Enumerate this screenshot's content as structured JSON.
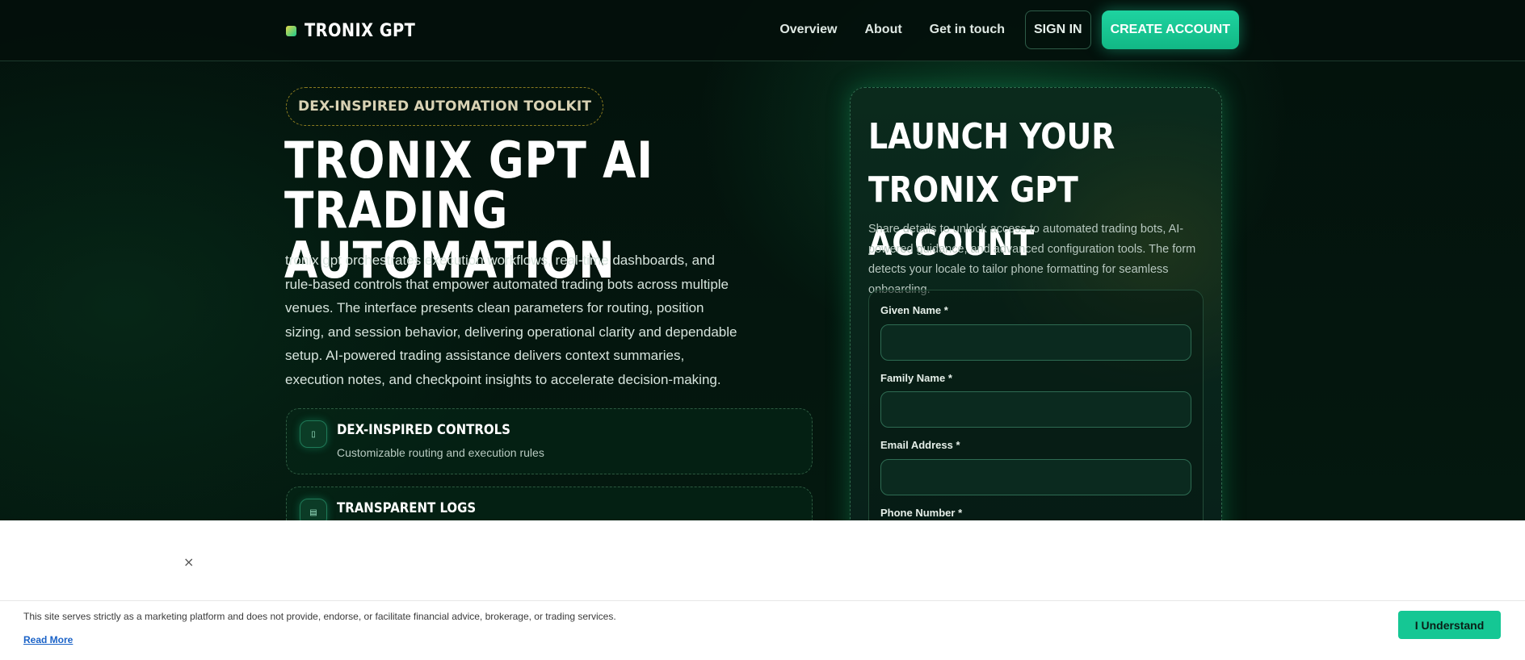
{
  "header": {
    "brand": "TRONIX GPT",
    "nav": [
      {
        "label": "Overview"
      },
      {
        "label": "About"
      },
      {
        "label": "Get in touch"
      }
    ],
    "signin_label": "SIGN IN",
    "create_label": "CREATE ACCOUNT"
  },
  "hero": {
    "badge": "DEX-INSPIRED AUTOMATION TOOLKIT",
    "title": "TRONIX GPT AI TRADING AUTOMATION",
    "description": "tronix gpt orchestrates execution workflows, real-time dashboards, and rule-based controls that empower automated trading bots across multiple venues. The interface presents clean parameters for routing, position sizing, and session behavior, delivering operational clarity and dependable setup. AI-powered trading assistance delivers context summaries, execution notes, and checkpoint insights to accelerate decision-making.",
    "features": [
      {
        "title": "DEX-INSPIRED CONTROLS",
        "subtitle": "Customizable routing and execution rules",
        "icon": "controls-icon",
        "glyph": "▯"
      },
      {
        "title": "TRANSPARENT LOGS",
        "subtitle": "",
        "icon": "logs-icon",
        "glyph": "▤"
      }
    ]
  },
  "signup": {
    "title": "LAUNCH YOUR TRONIX GPT ACCOUNT",
    "description": "Share details to unlock access to automated trading bots, AI-powered guidance, and advanced configuration tools. The form detects your locale to tailor phone formatting for seamless onboarding.",
    "fields": [
      {
        "label": "Given Name *",
        "value": ""
      },
      {
        "label": "Family Name *",
        "value": ""
      },
      {
        "label": "Email Address *",
        "value": ""
      },
      {
        "label": "Phone Number *",
        "value": ""
      }
    ]
  },
  "cookie": {
    "close": "×",
    "text": "This site serves strictly as a marketing platform and does not provide, endorse, or facilitate financial advice, brokerage, or trading services.",
    "read_more": "Read More",
    "accept": "I Understand"
  },
  "colors": {
    "accent": "#1ed3a0",
    "background": "#04150e",
    "badge_border": "#8a7a1f"
  }
}
